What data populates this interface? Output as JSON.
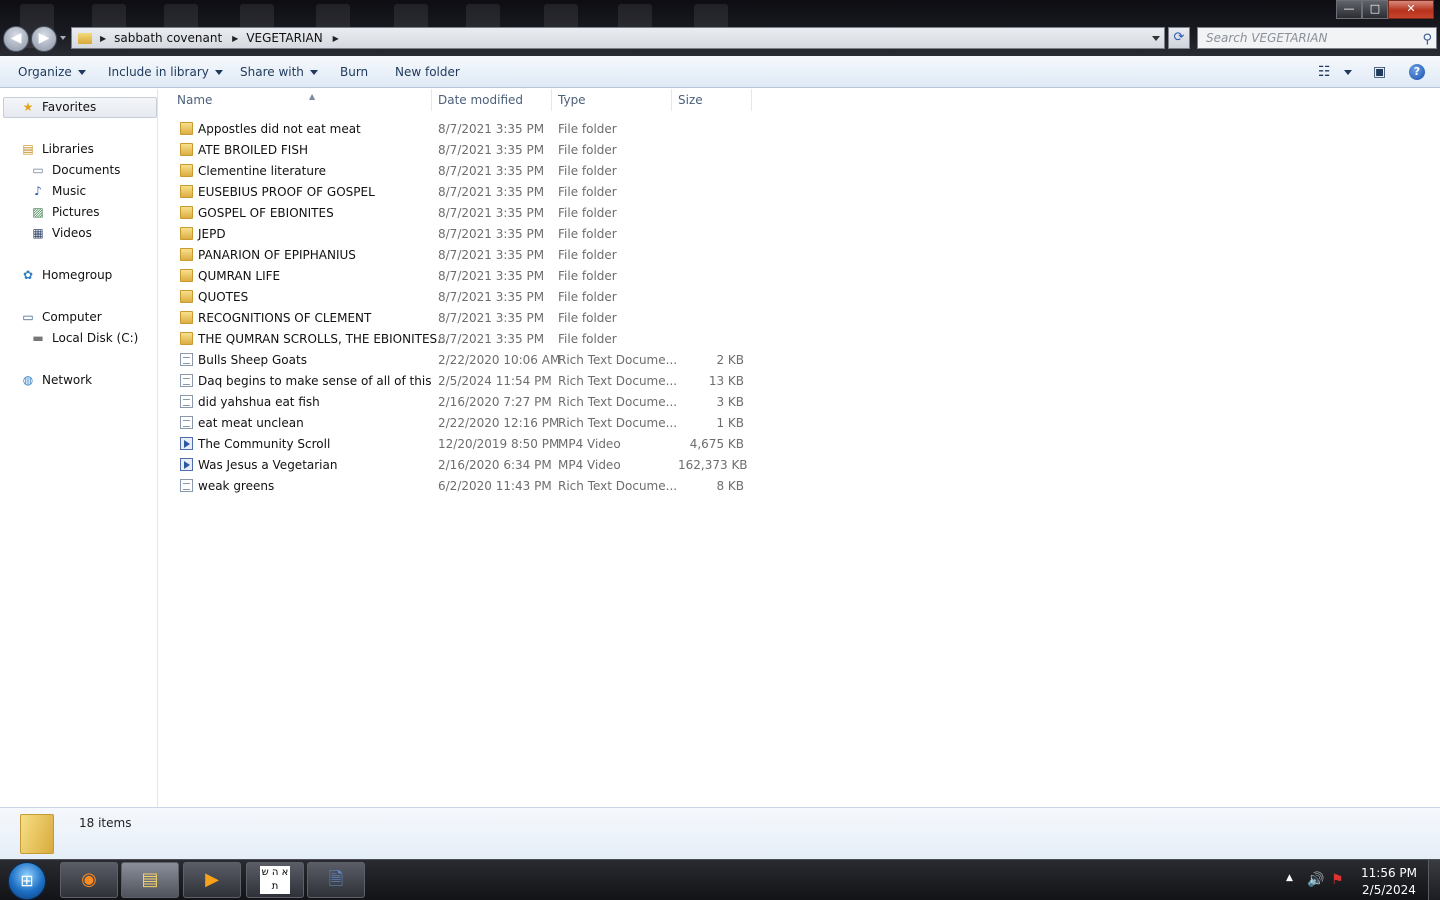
{
  "window": {
    "breadcrumbs": [
      "sabbath covenant",
      "VEGETARIAN"
    ],
    "search_placeholder": "Search VEGETARIAN",
    "controls": {
      "minimize": "—",
      "maximize": "□",
      "close": "✕"
    }
  },
  "toolbar": {
    "organize": "Organize",
    "include_in_library": "Include in library",
    "share_with": "Share with",
    "burn": "Burn",
    "new_folder": "New folder",
    "help": "?"
  },
  "nav": {
    "favorites": "Favorites",
    "libraries": "Libraries",
    "documents": "Documents",
    "music": "Music",
    "pictures": "Pictures",
    "videos": "Videos",
    "homegroup": "Homegroup",
    "computer": "Computer",
    "local_disk": "Local Disk (C:)",
    "network": "Network"
  },
  "columns": {
    "name": "Name",
    "date": "Date modified",
    "type": "Type",
    "size": "Size"
  },
  "files": [
    {
      "name": "Appostles did not eat meat",
      "date": "8/7/2021 3:35 PM",
      "type": "File folder",
      "size": "",
      "kind": "folder"
    },
    {
      "name": "ATE BROILED FISH",
      "date": "8/7/2021 3:35 PM",
      "type": "File folder",
      "size": "",
      "kind": "folder"
    },
    {
      "name": "Clementine literature",
      "date": "8/7/2021 3:35 PM",
      "type": "File folder",
      "size": "",
      "kind": "folder"
    },
    {
      "name": "EUSEBIUS PROOF OF GOSPEL",
      "date": "8/7/2021 3:35 PM",
      "type": "File folder",
      "size": "",
      "kind": "folder"
    },
    {
      "name": "GOSPEL OF EBIONITES",
      "date": "8/7/2021 3:35 PM",
      "type": "File folder",
      "size": "",
      "kind": "folder"
    },
    {
      "name": "JEPD",
      "date": "8/7/2021 3:35 PM",
      "type": "File folder",
      "size": "",
      "kind": "folder"
    },
    {
      "name": "PANARION OF EPIPHANIUS",
      "date": "8/7/2021 3:35 PM",
      "type": "File folder",
      "size": "",
      "kind": "folder"
    },
    {
      "name": "QUMRAN LIFE",
      "date": "8/7/2021 3:35 PM",
      "type": "File folder",
      "size": "",
      "kind": "folder"
    },
    {
      "name": "QUOTES",
      "date": "8/7/2021 3:35 PM",
      "type": "File folder",
      "size": "",
      "kind": "folder"
    },
    {
      "name": "RECOGNITIONS OF CLEMENT",
      "date": "8/7/2021 3:35 PM",
      "type": "File folder",
      "size": "",
      "kind": "folder"
    },
    {
      "name": "THE QUMRAN SCROLLS, THE EBIONITES...",
      "date": "8/7/2021 3:35 PM",
      "type": "File folder",
      "size": "",
      "kind": "folder"
    },
    {
      "name": "Bulls Sheep Goats",
      "date": "2/22/2020 10:06 AM",
      "type": "Rich Text Docume...",
      "size": "2 KB",
      "kind": "doc"
    },
    {
      "name": "Daq begins to make sense of all of this",
      "date": "2/5/2024 11:54 PM",
      "type": "Rich Text Docume...",
      "size": "13 KB",
      "kind": "doc"
    },
    {
      "name": "did yahshua eat fish",
      "date": "2/16/2020 7:27 PM",
      "type": "Rich Text Docume...",
      "size": "3 KB",
      "kind": "doc"
    },
    {
      "name": "eat meat unclean",
      "date": "2/22/2020 12:16 PM",
      "type": "Rich Text Docume...",
      "size": "1 KB",
      "kind": "doc"
    },
    {
      "name": "The Community Scroll",
      "date": "12/20/2019 8:50 PM",
      "type": "MP4 Video",
      "size": "4,675 KB",
      "kind": "video"
    },
    {
      "name": "Was Jesus a Vegetarian",
      "date": "2/16/2020 6:34 PM",
      "type": "MP4 Video",
      "size": "162,373 KB",
      "kind": "video"
    },
    {
      "name": "weak greens",
      "date": "6/2/2020 11:43 PM",
      "type": "Rich Text Docume...",
      "size": "8 KB",
      "kind": "doc"
    }
  ],
  "status": {
    "item_count": "18 items"
  },
  "taskbar": {
    "start": "⊞",
    "clock_time": "11:56 PM",
    "clock_date": "2/5/2024",
    "hebrew_app": "א ה ש ת"
  }
}
